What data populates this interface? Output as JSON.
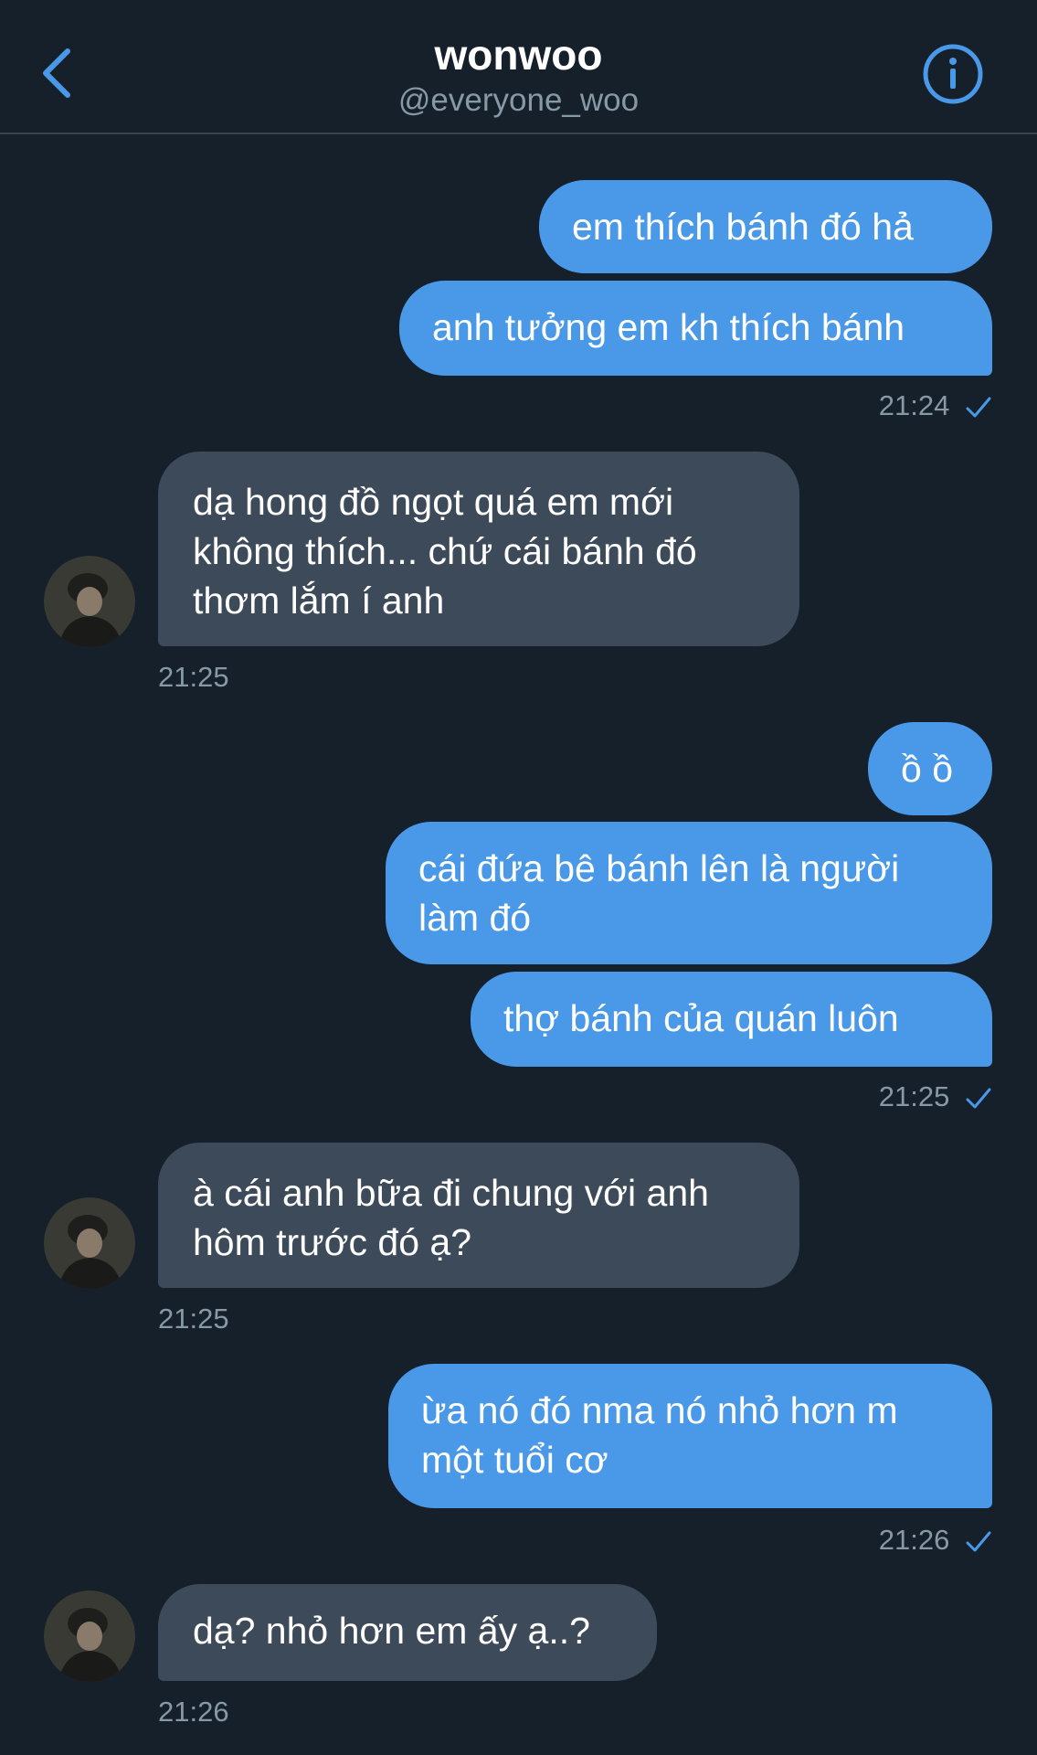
{
  "header": {
    "name": "wonwoo",
    "handle": "@everyone_woo",
    "back_icon": "chevron-left-icon",
    "info_icon": "info-icon",
    "accent_color": "#4a99e9"
  },
  "messages": [
    {
      "from": "me",
      "text": "em thích bánh đó hả"
    },
    {
      "from": "me",
      "text": "anh tưởng em kh thích bánh"
    },
    {
      "time": "21:24",
      "from": "me"
    },
    {
      "from": "them",
      "lines": [
        "dạ hong đồ ngọt quá em mới",
        "không thích... chứ cái bánh đó",
        "thơm lắm í anh"
      ]
    },
    {
      "time": "21:25",
      "from": "them"
    },
    {
      "from": "me",
      "text": "ồ ồ"
    },
    {
      "from": "me",
      "lines": [
        "cái đứa bê bánh lên là người",
        "làm đó"
      ]
    },
    {
      "from": "me",
      "text": "thợ bánh của quán luôn"
    },
    {
      "time": "21:25",
      "from": "me"
    },
    {
      "from": "them",
      "lines": [
        "à cái anh bữa đi chung với anh",
        "hôm trước đó ạ?"
      ]
    },
    {
      "time": "21:25",
      "from": "them"
    },
    {
      "from": "me",
      "lines": [
        "ừa nó đó nma nó nhỏ hơn m",
        "một tuổi cơ"
      ]
    },
    {
      "time": "21:26",
      "from": "me"
    },
    {
      "from": "them",
      "text": "dạ? nhỏ hơn em ấy ạ..?"
    },
    {
      "time": "21:26",
      "from": "them"
    }
  ]
}
